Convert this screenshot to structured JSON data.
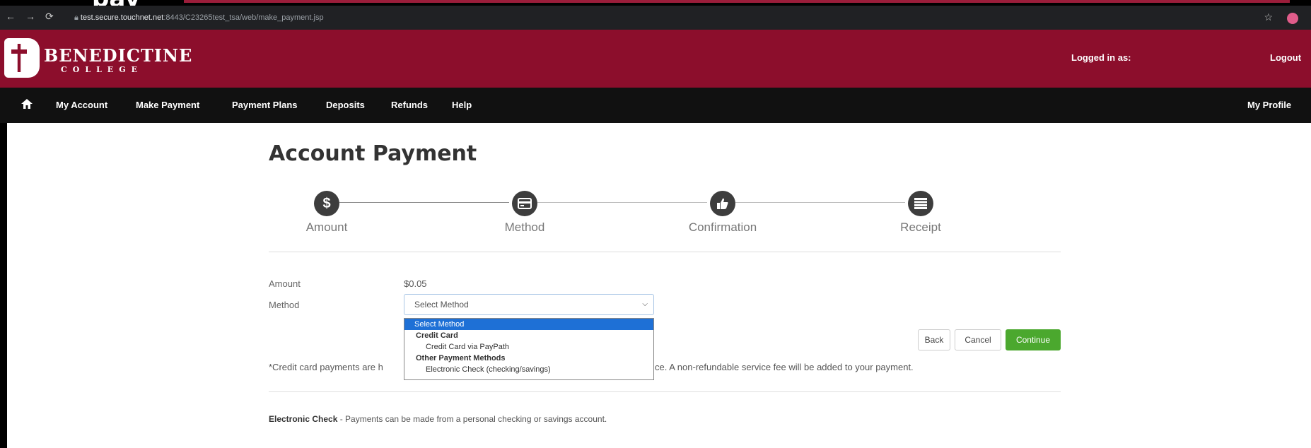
{
  "browser": {
    "url_host": "test.secure.touchnet.net",
    "url_path": ":8443/C23265test_tsa/web/make_payment.jsp",
    "back_icon": "arrow-left-icon",
    "forward_icon": "arrow-right-icon",
    "reload_icon": "reload-icon",
    "lock_icon": "lock-icon"
  },
  "partial_heading": "pay",
  "header": {
    "logo_name": "BENEDICTINE",
    "logo_sub": "COLLEGE",
    "logged_in_label": "Logged in as:",
    "logout_label": "Logout"
  },
  "nav": {
    "items": [
      {
        "label": "My Account"
      },
      {
        "label": "Make Payment"
      },
      {
        "label": "Payment Plans"
      },
      {
        "label": "Deposits"
      },
      {
        "label": "Refunds"
      },
      {
        "label": "Help"
      }
    ],
    "profile_label": "My Profile"
  },
  "page": {
    "title": "Account Payment",
    "steps": [
      {
        "label": "Amount",
        "icon": "dollar-icon"
      },
      {
        "label": "Method",
        "icon": "credit-card-icon"
      },
      {
        "label": "Confirmation",
        "icon": "thumbs-up-icon"
      },
      {
        "label": "Receipt",
        "icon": "list-icon"
      }
    ],
    "amount_label": "Amount",
    "amount_value": "$0.05",
    "method_label": "Method",
    "method_selected": "Select Method",
    "dropdown": {
      "selected_option": "Select Method",
      "group1": "Credit Card",
      "group1_option": "Credit Card via PayPath",
      "group2": "Other Payment Methods",
      "group2_option": "Electronic Check (checking/savings)"
    },
    "buttons": {
      "back": "Back",
      "cancel": "Cancel",
      "continue": "Continue"
    },
    "cc_note_start": "*Credit card payments are h",
    "cc_note_end": "ce. A non-refundable service fee will be added to your payment.",
    "echeck_title": "Electronic Check",
    "echeck_text": " - Payments can be made from a personal checking or savings account."
  },
  "colors": {
    "brand_red": "#8c0e2c",
    "nav_black": "#111111",
    "continue_green": "#4ba82e",
    "select_highlight": "#1e70d6"
  }
}
